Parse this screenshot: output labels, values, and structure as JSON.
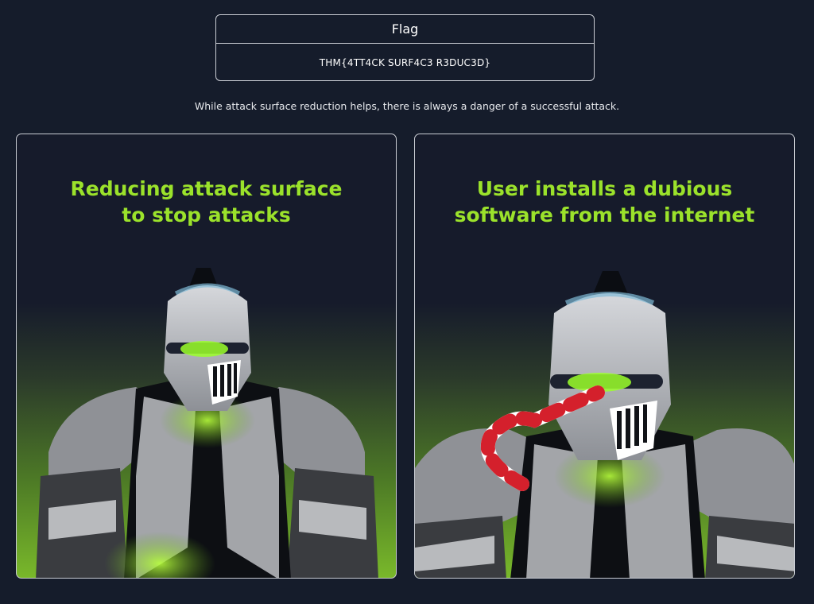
{
  "flag": {
    "header": "Flag",
    "value": "THM{4TT4CK SURF4C3 R3DUC3D}"
  },
  "caption": "While attack surface reduction helps, there is always a danger of a successful attack.",
  "panels": [
    {
      "title": "Reducing attack surface\nto stop attacks"
    },
    {
      "title": "User installs a dubious\nsoftware from the internet"
    }
  ],
  "colors": {
    "background": "#151c2b",
    "accent_green": "#9be22b",
    "armor_gray": "#a9abaf",
    "candy_red": "#d4202c"
  },
  "icons": [
    "knight-illustration",
    "candy-cane"
  ]
}
